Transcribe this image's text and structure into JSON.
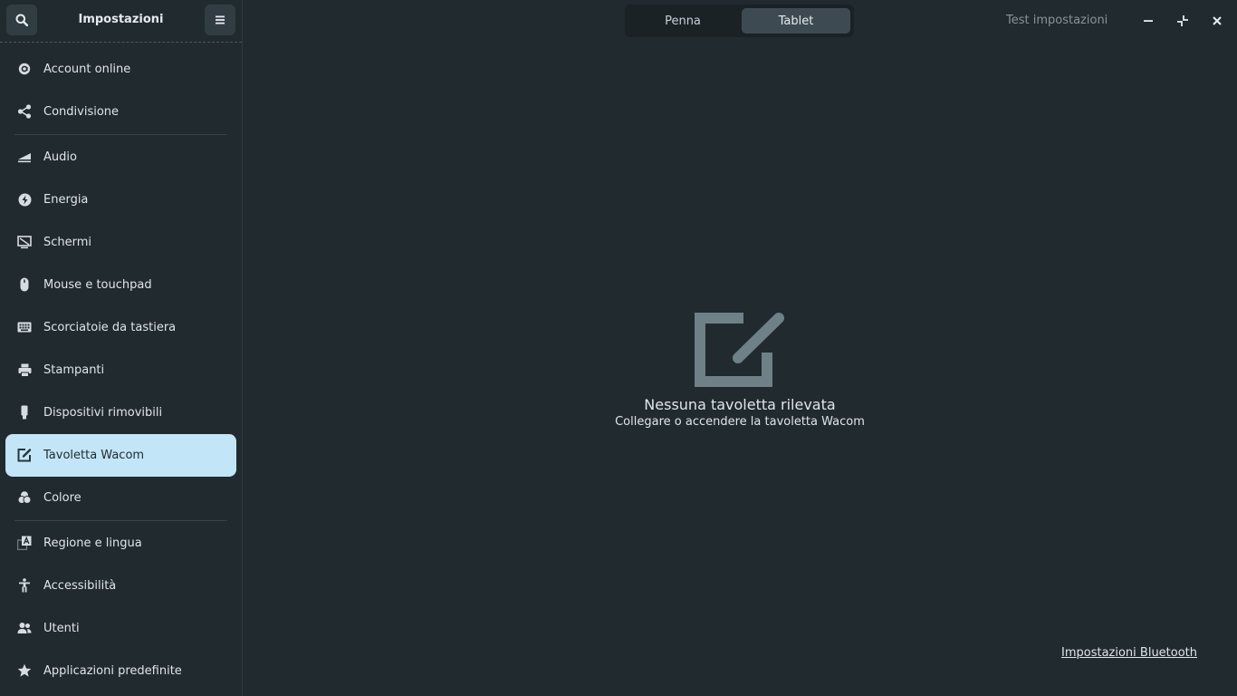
{
  "sidebar": {
    "title": "Impostazioni",
    "items": [
      {
        "label": "Account online",
        "icon": "at-icon"
      },
      {
        "label": "Condivisione",
        "icon": "share-icon"
      },
      {
        "label": "Audio",
        "icon": "audio-icon"
      },
      {
        "label": "Energia",
        "icon": "power-icon"
      },
      {
        "label": "Schermi",
        "icon": "display-icon"
      },
      {
        "label": "Mouse e touchpad",
        "icon": "mouse-icon"
      },
      {
        "label": "Scorciatoie da tastiera",
        "icon": "keyboard-icon"
      },
      {
        "label": "Stampanti",
        "icon": "printer-icon"
      },
      {
        "label": "Dispositivi rimovibili",
        "icon": "removable-media-icon"
      },
      {
        "label": "Tavoletta Wacom",
        "icon": "tablet-pen-icon"
      },
      {
        "label": "Colore",
        "icon": "color-icon"
      },
      {
        "label": "Regione e lingua",
        "icon": "region-language-icon"
      },
      {
        "label": "Accessibilità",
        "icon": "accessibility-icon"
      },
      {
        "label": "Utenti",
        "icon": "users-icon"
      },
      {
        "label": "Applicazioni predefinite",
        "icon": "star-icon"
      }
    ],
    "active_item": "Tavoletta Wacom"
  },
  "topbar": {
    "tabs": [
      {
        "label": "Penna"
      },
      {
        "label": "Tablet"
      }
    ],
    "selected_tab": "Tablet",
    "test_label": "Test impostazioni"
  },
  "main": {
    "empty_title": "Nessuna tavoletta rilevata",
    "empty_subtitle": "Collegare o accendere la tavoletta Wacom",
    "bluetooth_link": "Impostazioni Bluetooth"
  },
  "colors": {
    "background": "#212a2f",
    "active_item": "#c3e5f8",
    "icon_muted": "#6f8087"
  }
}
